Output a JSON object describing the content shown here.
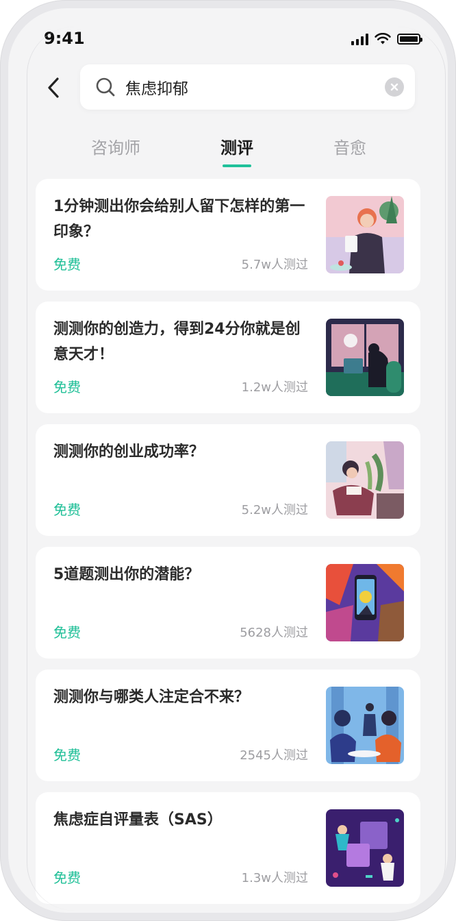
{
  "status_bar": {
    "time": "9:41"
  },
  "search": {
    "value": "焦虑抑郁"
  },
  "tabs": [
    {
      "label": "咨询师",
      "active": false
    },
    {
      "label": "测评",
      "active": true
    },
    {
      "label": "音愈",
      "active": false
    }
  ],
  "colors": {
    "accent": "#20c19a",
    "price": "#1fbf97"
  },
  "results": [
    {
      "title": "1分钟测出你会给别人留下怎样的第一印象？",
      "price": "免费",
      "count": "5.7w人测过"
    },
    {
      "title": "测测你的创造力，得到24分你就是创意天才！",
      "price": "免费",
      "count": "1.2w人测过"
    },
    {
      "title": "测测你的创业成功率？",
      "price": "免费",
      "count": "5.2w人测过"
    },
    {
      "title": "5道题测出你的潜能？",
      "price": "免费",
      "count": "5628人测过"
    },
    {
      "title": "测测你与哪类人注定合不来？",
      "price": "免费",
      "count": "2545人测过"
    },
    {
      "title": "焦虑症自评量表（SAS）",
      "price": "免费",
      "count": "1.3w人测过"
    }
  ]
}
